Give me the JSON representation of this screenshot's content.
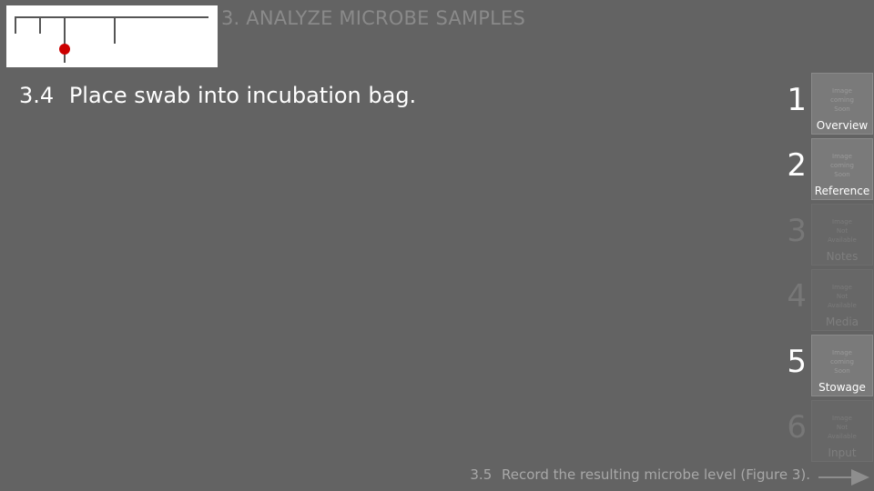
{
  "header": {
    "section_title": "3. ANALYZE MICROBE SAMPLES"
  },
  "progress": {
    "total_steps": 4,
    "current_step": 3,
    "marker_color": "#cc0000"
  },
  "current_step": {
    "number": "3.4",
    "text": "Place swab into incubation bag."
  },
  "tabs": [
    {
      "number": "1",
      "label": "Overview",
      "placeholder": "Image\ncoming\nSoon",
      "enabled": true
    },
    {
      "number": "2",
      "label": "Reference",
      "placeholder": "Image\ncoming\nSoon",
      "enabled": true
    },
    {
      "number": "3",
      "label": "Notes",
      "placeholder": "Image\nNot\nAvailable",
      "enabled": false
    },
    {
      "number": "4",
      "label": "Media",
      "placeholder": "Image\nNot\nAvailable",
      "enabled": false
    },
    {
      "number": "5",
      "label": "Stowage",
      "placeholder": "Image\ncoming\nSoon",
      "enabled": true
    },
    {
      "number": "6",
      "label": "Input",
      "placeholder": "Image\nNot\nAvailable",
      "enabled": false
    }
  ],
  "next_step": {
    "number": "3.5",
    "text": "Record the resulting microbe level (Figure 3).",
    "icon": "arrow-right-icon"
  }
}
